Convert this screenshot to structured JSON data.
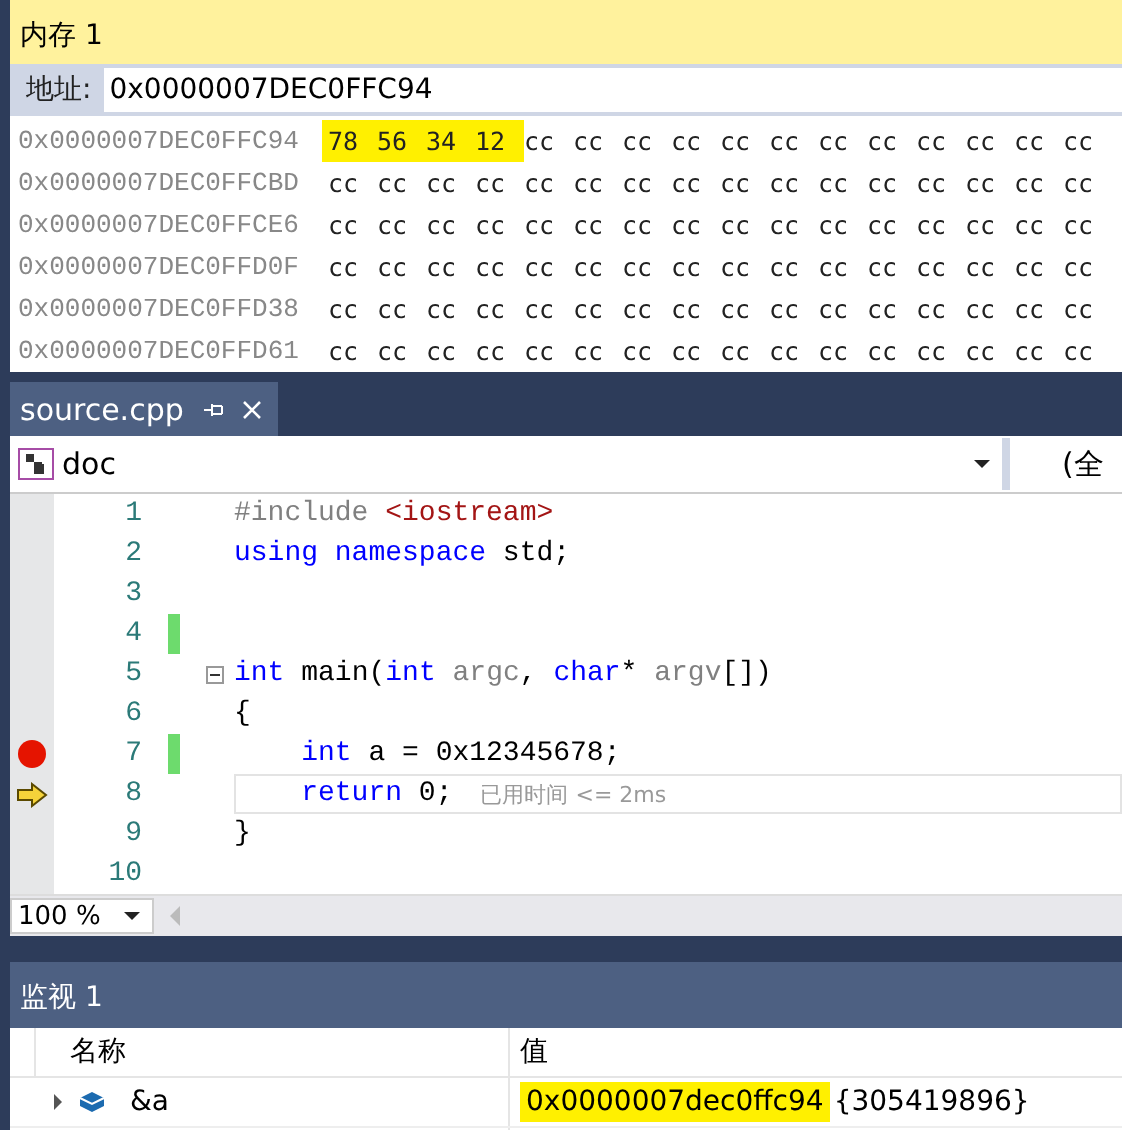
{
  "memory": {
    "title": "内存 1",
    "address_label": "地址:",
    "address_value": "0x0000007DEC0FFC94",
    "rows": [
      {
        "address": "0x0000007DEC0FFC94",
        "marked": [
          "78",
          "56",
          "34",
          "12"
        ],
        "bytes": [
          "cc",
          "cc",
          "cc",
          "cc",
          "cc",
          "cc",
          "cc",
          "cc",
          "cc",
          "cc",
          "cc",
          "cc"
        ]
      },
      {
        "address": "0x0000007DEC0FFCBD",
        "marked": [],
        "bytes": [
          "cc",
          "cc",
          "cc",
          "cc",
          "cc",
          "cc",
          "cc",
          "cc",
          "cc",
          "cc",
          "cc",
          "cc",
          "cc",
          "cc",
          "cc",
          "cc"
        ]
      },
      {
        "address": "0x0000007DEC0FFCE6",
        "marked": [],
        "bytes": [
          "cc",
          "cc",
          "cc",
          "cc",
          "cc",
          "cc",
          "cc",
          "cc",
          "cc",
          "cc",
          "cc",
          "cc",
          "cc",
          "cc",
          "cc",
          "cc"
        ]
      },
      {
        "address": "0x0000007DEC0FFD0F",
        "marked": [],
        "bytes": [
          "cc",
          "cc",
          "cc",
          "cc",
          "cc",
          "cc",
          "cc",
          "cc",
          "cc",
          "cc",
          "cc",
          "cc",
          "cc",
          "cc",
          "cc",
          "cc"
        ]
      },
      {
        "address": "0x0000007DEC0FFD38",
        "marked": [],
        "bytes": [
          "cc",
          "cc",
          "cc",
          "cc",
          "cc",
          "cc",
          "cc",
          "cc",
          "cc",
          "cc",
          "cc",
          "cc",
          "cc",
          "cc",
          "cc",
          "cc"
        ]
      },
      {
        "address": "0x0000007DEC0FFD61",
        "marked": [],
        "bytes": [
          "cc",
          "cc",
          "cc",
          "cc",
          "cc",
          "cc",
          "cc",
          "cc",
          "cc",
          "cc",
          "cc",
          "cc",
          "cc",
          "cc",
          "cc",
          "cc"
        ]
      }
    ]
  },
  "editor": {
    "tab": {
      "label": "source.cpp",
      "selected": true
    },
    "scope": "doc",
    "scope_right": "(全",
    "lines": [
      {
        "number": "1",
        "breakpoint": false,
        "current": false,
        "changed": false,
        "fold": false,
        "tokens": [
          {
            "text": "#include ",
            "kind": "pp"
          },
          {
            "text": "<iostream>",
            "kind": "str"
          }
        ]
      },
      {
        "number": "2",
        "breakpoint": false,
        "current": false,
        "changed": false,
        "fold": false,
        "tokens": [
          {
            "text": "using",
            "kind": "kw"
          },
          {
            "text": "namespace",
            "kind": "kw"
          },
          {
            "text": " std;",
            "kind": "plain"
          }
        ]
      },
      {
        "number": "3",
        "breakpoint": false,
        "current": false,
        "changed": false,
        "fold": false
      },
      {
        "number": "4",
        "breakpoint": false,
        "current": false,
        "changed": true,
        "fold": false
      },
      {
        "number": "5",
        "breakpoint": false,
        "current": false,
        "changed": false,
        "fold": true,
        "tokens": [
          {
            "text": "int",
            "kind": "kw"
          },
          {
            "text": " main(",
            "kind": "plain"
          },
          {
            "text": "int",
            "kind": "kw"
          },
          {
            "text": " argc",
            "kind": "param"
          },
          {
            "text": ", ",
            "kind": "plain"
          },
          {
            "text": "char",
            "kind": "kw"
          },
          {
            "text": "* ",
            "kind": "plain"
          },
          {
            "text": "argv",
            "kind": "param"
          },
          {
            "text": "[])",
            "kind": "plain"
          }
        ]
      },
      {
        "number": "6",
        "breakpoint": false,
        "current": false,
        "changed": false,
        "fold": false,
        "tokens": [
          {
            "text": "{",
            "kind": "plain"
          }
        ]
      },
      {
        "number": "7",
        "breakpoint": true,
        "current": false,
        "changed": true,
        "fold": false,
        "indented": true,
        "tokens": [
          {
            "text": "int",
            "kind": "kw"
          },
          {
            "text": " a = 0x12345678;",
            "kind": "plain"
          }
        ]
      },
      {
        "number": "8",
        "breakpoint": false,
        "current": true,
        "changed": false,
        "fold": false,
        "hint": "已用时间 <= 2ms",
        "indented": true,
        "tokens": [
          {
            "text": "return",
            "kind": "kw"
          },
          {
            "text": " 0;",
            "kind": "plain"
          }
        ]
      },
      {
        "number": "9",
        "breakpoint": false,
        "current": false,
        "changed": false,
        "fold": false,
        "tokens": [
          {
            "text": "}",
            "kind": "plain"
          }
        ]
      },
      {
        "number": "10",
        "breakpoint": false,
        "current": false,
        "changed": false,
        "fold": false
      }
    ],
    "zoom": "100 %"
  },
  "watch": {
    "title": "监视 1",
    "columns": [
      "名称",
      "值"
    ],
    "rows": [
      {
        "name": "&a",
        "expanded": false,
        "value": "0x0000007dec0ffc94",
        "value_highlighted": true,
        "extra": "{305419896}"
      }
    ]
  }
}
